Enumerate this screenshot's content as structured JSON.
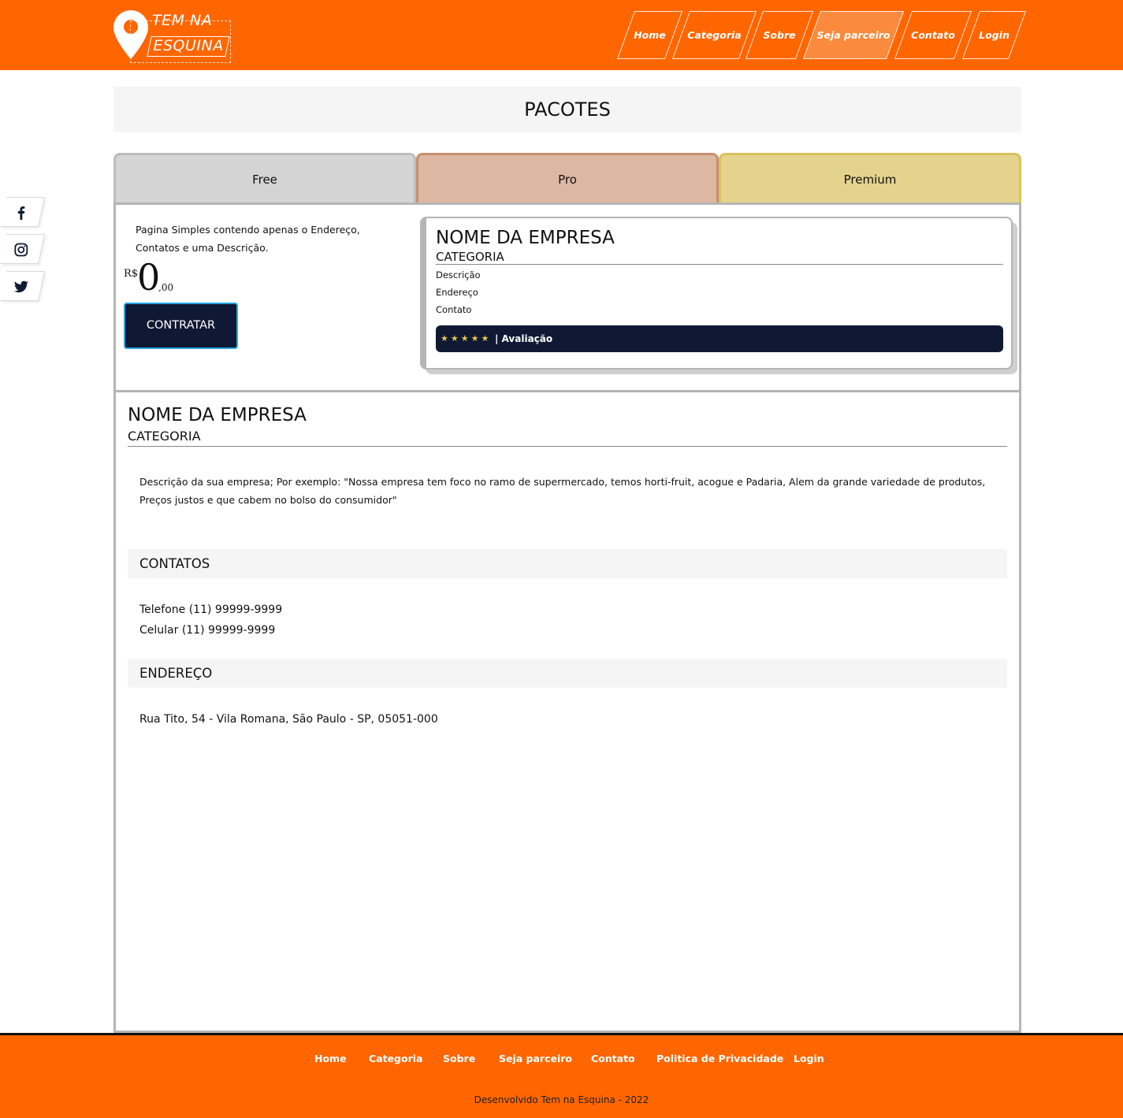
{
  "brand": {
    "line1": "TEM NA",
    "line2": "ESQUINA"
  },
  "nav": [
    {
      "label": "Home"
    },
    {
      "label": "Categoria"
    },
    {
      "label": "Sobre"
    },
    {
      "label": "Seja parceiro",
      "active": true
    },
    {
      "label": "Contato"
    },
    {
      "label": "Login"
    }
  ],
  "social": [
    "facebook-icon",
    "instagram-icon",
    "twitter-icon"
  ],
  "page_title": "PACOTES",
  "tabs": [
    "Free",
    "Pro",
    "Premium"
  ],
  "package": {
    "description": "Pagina Simples contendo apenas o Endereço, Contatos e uma Descrição.",
    "currency": "R$",
    "price_int": "0",
    "price_dec": ",00",
    "button": "CONTRATAR"
  },
  "preview_card": {
    "title": "NOME DA EMPRESA",
    "category": "CATEGORIA",
    "rows": [
      "Descrição",
      "Endereço",
      "Contato"
    ],
    "stars": "★★★★★",
    "rating_label": "| Avaliação"
  },
  "detail": {
    "title": "NOME DA EMPRESA",
    "category": "CATEGORIA",
    "description": "Descrição da sua empresa; Por exemplo: \"Nossa empresa tem foco no ramo de supermercado, temos horti-fruit, acogue e Padaria, Alem da grande variedade de produtos, Preços justos e que cabem no bolso do consumidor\"",
    "contacts_heading": "CONTATOS",
    "phone": "Telefone (11) 99999-9999",
    "mobile": "Celular (11) 99999-9999",
    "address_heading": "ENDEREÇO",
    "address": "Rua Tito, 54 - Vila Romana, São Paulo - SP, 05051-000"
  },
  "footer": {
    "links": [
      "Home",
      "Categoria",
      "Sobre",
      "Seja parceiro",
      "Contato",
      "Politica de Privacidade",
      "Login"
    ],
    "copyright": "Desenvolvido Tem na Esquina - 2022"
  },
  "colors": {
    "brand_orange": "#ff6600",
    "navy": "#0f1933",
    "free": "#d4d4d4",
    "pro": "#dcb8a3",
    "premium": "#e3d38c"
  }
}
